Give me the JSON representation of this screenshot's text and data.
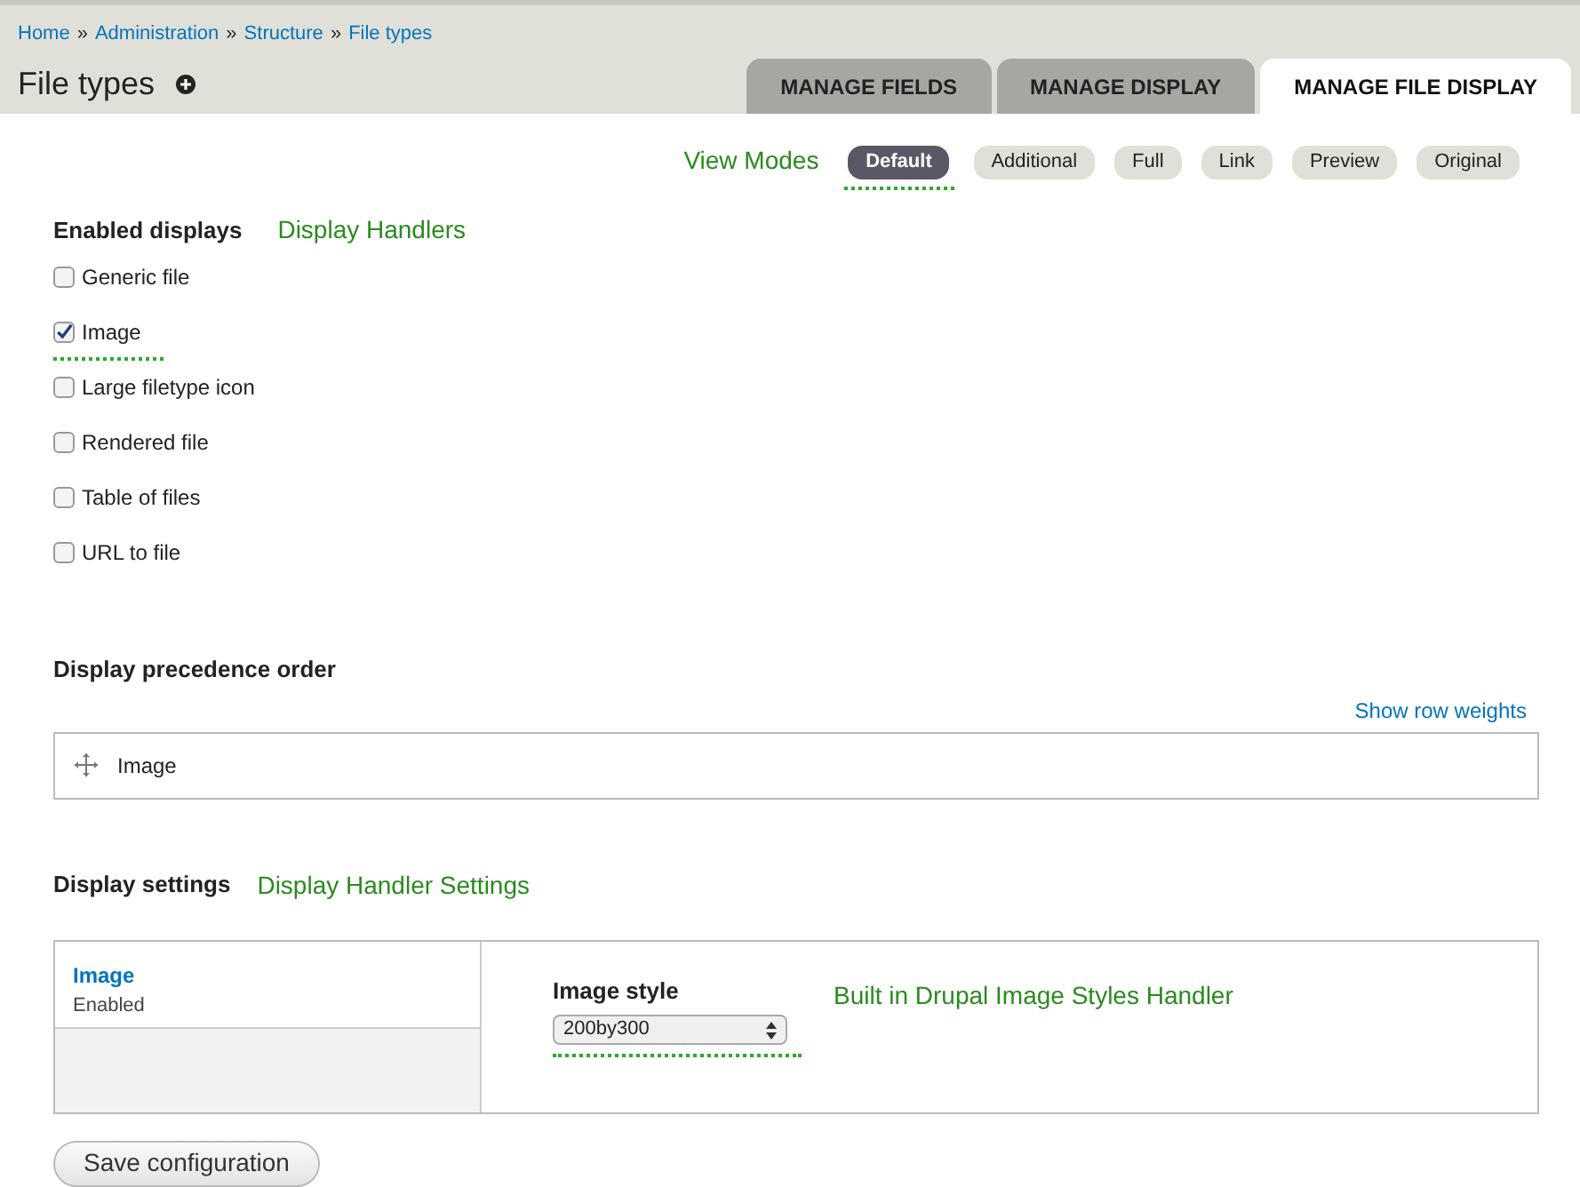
{
  "breadcrumb": [
    "Home",
    "Administration",
    "Structure",
    "File types"
  ],
  "breadcrumb_separator": "»",
  "title": "File types",
  "tabs": [
    {
      "label": "MANAGE FIELDS",
      "selected": false
    },
    {
      "label": "MANAGE DISPLAY",
      "selected": false
    },
    {
      "label": "MANAGE FILE DISPLAY",
      "selected": true
    }
  ],
  "view_modes": {
    "annotation": "View Modes",
    "items": [
      {
        "label": "Default",
        "selected": true
      },
      {
        "label": "Additional",
        "selected": false
      },
      {
        "label": "Full",
        "selected": false
      },
      {
        "label": "Link",
        "selected": false
      },
      {
        "label": "Preview",
        "selected": false
      },
      {
        "label": "Original",
        "selected": false
      }
    ]
  },
  "enabled_displays": {
    "heading": "Enabled displays",
    "annotation": "Display Handlers",
    "items": [
      {
        "label": "Generic file",
        "checked": false
      },
      {
        "label": "Image",
        "checked": true
      },
      {
        "label": "Large filetype icon",
        "checked": false
      },
      {
        "label": "Rendered file",
        "checked": false
      },
      {
        "label": "Table of files",
        "checked": false
      },
      {
        "label": "URL to file",
        "checked": false
      }
    ]
  },
  "precedence": {
    "heading": "Display precedence order",
    "link": "Show row weights",
    "rows": [
      "Image"
    ]
  },
  "settings": {
    "heading": "Display settings",
    "annotation": "Display Handler Settings",
    "tab": {
      "title": "Image",
      "status": "Enabled"
    },
    "field_label": "Image style",
    "field_value": "200by300",
    "field_annotation": "Built in Drupal Image Styles Handler"
  },
  "save_button": "Save configuration"
}
